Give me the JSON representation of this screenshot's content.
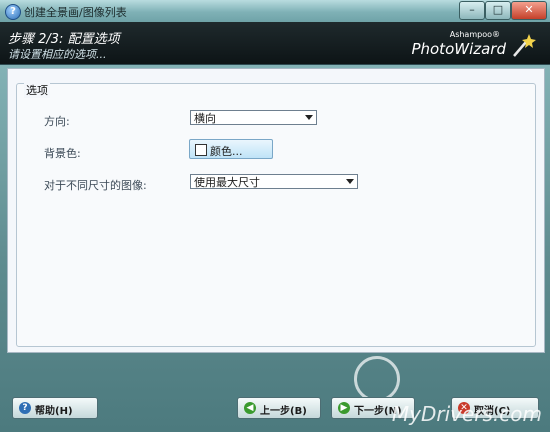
{
  "window": {
    "title": "创建全景画/图像列表",
    "controls": {
      "minimize": "–",
      "maximize": "□",
      "close": "✕"
    }
  },
  "header": {
    "step_title": "步骤 2/3: 配置选项",
    "step_subtitle": "请设置相应的选项...",
    "brand_small": "Ashampoo®",
    "brand_big": "PhotoWizard"
  },
  "options": {
    "group_label": "选项",
    "orientation": {
      "label": "方向:",
      "value": "横向"
    },
    "background": {
      "label": "背景色:",
      "button_label": "颜色..."
    },
    "image_size": {
      "label": "对于不同尺寸的图像:",
      "value": "使用最大尺寸"
    }
  },
  "footer": {
    "help_label": "帮助(H)",
    "back_label": "上一步(B)",
    "next_label": "下一步(N)",
    "cancel_label": "取消(C)",
    "watermark": "MyDrivers.com"
  },
  "colors": {
    "header_bg": "#0d1416",
    "accent": "#6fa3a8",
    "content_bg": "#f4f7fb"
  }
}
